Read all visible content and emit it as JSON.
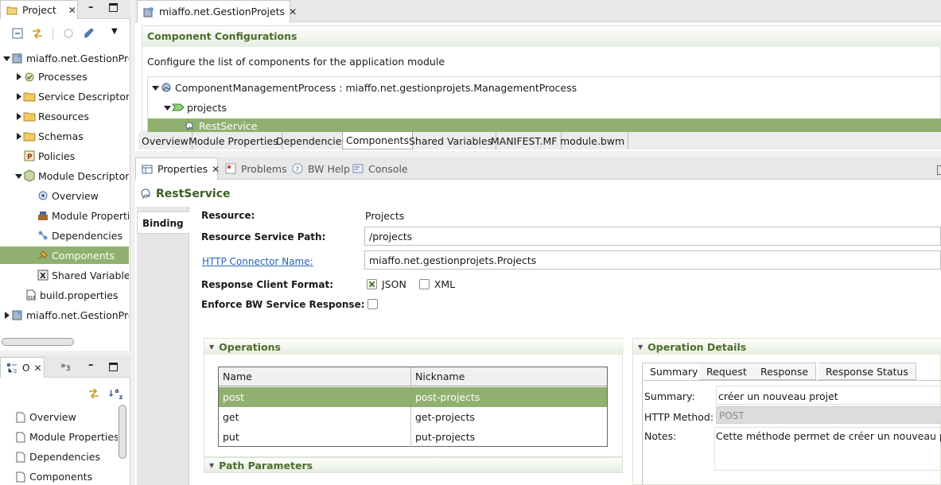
{
  "project_panel": {
    "tab_label": "Project",
    "tree": [
      {
        "label": "miaffo.net.GestionProj",
        "icon": "module-icon",
        "depth": 0,
        "expanded": true
      },
      {
        "label": "Processes",
        "icon": "processes-icon",
        "depth": 1,
        "expanded": false
      },
      {
        "label": "Service Descriptors",
        "icon": "folder-icon",
        "depth": 1,
        "expanded": false
      },
      {
        "label": "Resources",
        "icon": "folder-icon",
        "depth": 1,
        "expanded": false
      },
      {
        "label": "Schemas",
        "icon": "folder-icon",
        "depth": 1,
        "expanded": false
      },
      {
        "label": "Policies",
        "icon": "policies-icon",
        "depth": 1,
        "expanded": null
      },
      {
        "label": "Module Descriptors",
        "icon": "module-descriptors-icon",
        "depth": 1,
        "expanded": true
      },
      {
        "label": "Overview",
        "icon": "overview-icon",
        "depth": 2,
        "expanded": null
      },
      {
        "label": "Module Propertie",
        "icon": "module-properties-icon",
        "depth": 2,
        "expanded": null
      },
      {
        "label": "Dependencies",
        "icon": "dependencies-icon",
        "depth": 2,
        "expanded": null
      },
      {
        "label": "Components",
        "icon": "components-icon",
        "depth": 2,
        "expanded": null,
        "selected": true
      },
      {
        "label": "Shared Variables",
        "icon": "shared-variables-icon",
        "depth": 2,
        "expanded": null
      },
      {
        "label": "build.properties",
        "icon": "file-icon",
        "depth": 1,
        "expanded": null
      },
      {
        "label": "miaffo.net.GestionProj",
        "icon": "module-icon",
        "depth": 0,
        "expanded": false
      }
    ]
  },
  "outline_panel": {
    "tab_label": "O",
    "overflow_label": "»",
    "overflow_count": "3",
    "items": [
      "Overview",
      "Module Properties",
      "Dependencies",
      "Components"
    ]
  },
  "editor": {
    "tab_label": "miaffo.net.GestionProjets",
    "section_title": "Component Configurations",
    "description": "Configure the list of components for the application module",
    "tree": [
      {
        "label": "ComponentManagementProcess : miaffo.net.gestionprojets.ManagementProcess",
        "depth": 0
      },
      {
        "label": "projects",
        "depth": 1
      },
      {
        "label": "RestService",
        "depth": 2,
        "selected": true
      }
    ],
    "bottom_tabs": [
      "Overview",
      "Module Properties",
      "Dependencies",
      "Components",
      "Shared Variables",
      "MANIFEST.MF",
      "module.bwm"
    ],
    "active_bottom_tab": 3
  },
  "views": {
    "tabs": [
      "Properties",
      "Problems",
      "BW Help",
      "Console"
    ],
    "active": 0
  },
  "properties": {
    "title": "RestService",
    "side_tab": "Binding",
    "resource_label": "Resource:",
    "resource_value": "Projects",
    "service_path_label": "Resource Service Path:",
    "service_path_value": "/projects",
    "http_connector_label": "HTTP Connector Name:",
    "http_connector_value": "miaffo.net.gestionprojets.Projects",
    "response_format_label": "Response Client Format:",
    "format_json": "JSON",
    "format_xml": "XML",
    "json_checked": true,
    "xml_checked": false,
    "enforce_label": "Enforce BW Service Response:",
    "enforce_checked": false,
    "operations_title": "Operations",
    "operations_columns": [
      "Name",
      "Nickname"
    ],
    "operations_rows": [
      {
        "name": "post",
        "nickname": "post-projects",
        "selected": true
      },
      {
        "name": "get",
        "nickname": "get-projects",
        "selected": false
      },
      {
        "name": "put",
        "nickname": "put-projects",
        "selected": false
      }
    ],
    "path_params_title": "Path Parameters",
    "operation_details_title": "Operation Details",
    "detail_tabs": [
      "Summary",
      "Request",
      "Response",
      "Response Status"
    ],
    "active_detail_tab": 0,
    "summary_label": "Summary:",
    "summary_value": "créer un nouveau projet",
    "http_method_label": "HTTP Method:",
    "http_method_value": "POST",
    "notes_label": "Notes:",
    "notes_value": "Cette méthode permet de créer un nouveau projet."
  }
}
